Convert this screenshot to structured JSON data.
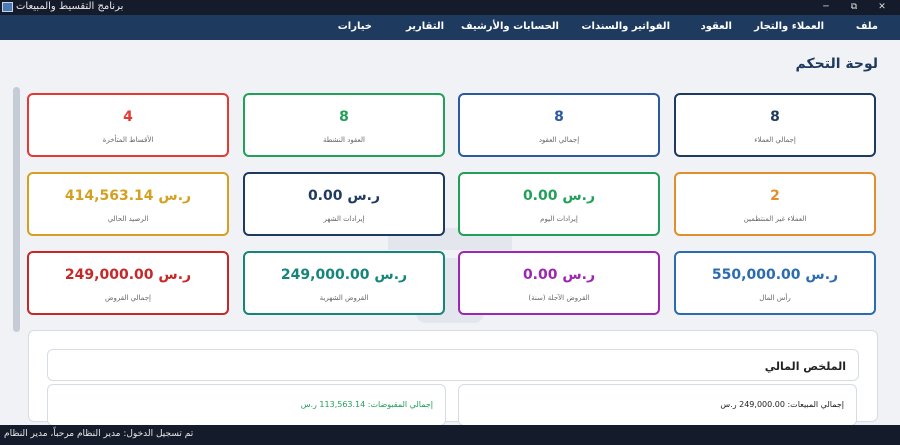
{
  "window": {
    "title": "برنامج التقسيط والمبيعات",
    "min": "─",
    "max": "⧉",
    "close": "✕"
  },
  "menu": [
    {
      "label": "ملف",
      "key": "file"
    },
    {
      "label": "العملاء والتجار",
      "key": "customers"
    },
    {
      "label": "العقود",
      "key": "contracts"
    },
    {
      "label": "الفواتير والسندات",
      "key": "invoices"
    },
    {
      "label": "الحسابات والأرشيف",
      "key": "accounts"
    },
    {
      "label": "التقارير",
      "key": "reports"
    },
    {
      "label": "خيارات",
      "key": "options"
    }
  ],
  "page_title": "لوحة التحكم",
  "cards": [
    {
      "value": "8",
      "label": "إجمالي العملاء",
      "color": "#1e3a5f"
    },
    {
      "value": "8",
      "label": "إجمالي العقود",
      "color": "#2b5aa0"
    },
    {
      "value": "8",
      "label": "العقود النشطة",
      "color": "#22a05a"
    },
    {
      "value": "4",
      "label": "الأقساط المتأخرة",
      "color": "#e53935"
    },
    {
      "value": "2",
      "label": "العملاء غير المنتظمين",
      "color": "#e0902a"
    },
    {
      "value": "0.00 ر.س",
      "label": "إيرادات اليوم",
      "color": "#22a05a"
    },
    {
      "value": "0.00 ر.س",
      "label": "إيرادات الشهر",
      "color": "#1e3a5f"
    },
    {
      "value": "414,563.14 ر.س",
      "label": "الرصيد الحالي",
      "color": "#d4a020"
    },
    {
      "value": "550,000.00 ر.س",
      "label": "رأس المال",
      "color": "#2b6cb0"
    },
    {
      "value": "0.00 ر.س",
      "label": "القروض الآجلة (سنة)",
      "color": "#9c27b0"
    },
    {
      "value": "249,000.00 ر.س",
      "label": "القروض الشهرية",
      "color": "#14857a"
    },
    {
      "value": "249,000.00 ر.س",
      "label": "إجمالي القروض",
      "color": "#c62828"
    }
  ],
  "summary": {
    "title": "الملخص المالي",
    "total_sales": "إجمالي المبيعات: 249,000.00 ر.س",
    "total_collected": "إجمالي المقبوضات: 113,563.14 ر.س",
    "collected_color": "#22a05a"
  },
  "status": "تم تسجيل الدخول: مدير النظام مرحباً، مدير النظام"
}
